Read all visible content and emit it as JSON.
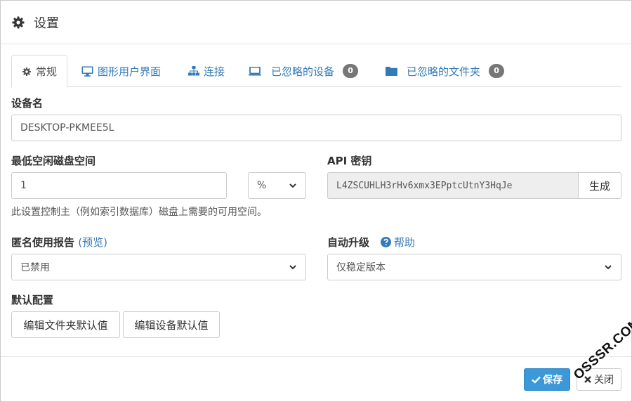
{
  "header": {
    "title": "设置",
    "icon": "gear-icon"
  },
  "tabs": [
    {
      "label": "常规",
      "icon": "gear-icon",
      "active": true
    },
    {
      "label": "图形用户界面",
      "icon": "desktop-icon"
    },
    {
      "label": "连接",
      "icon": "sitemap-icon"
    },
    {
      "label": "已忽略的设备",
      "icon": "laptop-icon",
      "badge": "0"
    },
    {
      "label": "已忽略的文件夹",
      "icon": "folder-icon",
      "badge": "0"
    }
  ],
  "device_name": {
    "label": "设备名",
    "value": "DESKTOP-PKMEE5L"
  },
  "min_disk": {
    "label": "最低空闲磁盘空间",
    "value": "1",
    "unit": "%",
    "help": "此设置控制主（例如索引数据库）磁盘上需要的可用空间。"
  },
  "api_key": {
    "label": "API 密钥",
    "value": "L4ZSCUHLH3rHv6xmx3EPptcUtnY3HqJe",
    "generate_label": "生成"
  },
  "usage_report": {
    "label": "匿名使用报告",
    "preview_open": "(",
    "preview_link": "预览",
    "preview_close": ")",
    "value": "已禁用"
  },
  "auto_upgrade": {
    "label": "自动升级",
    "help_label": "帮助",
    "value": "仅稳定版本"
  },
  "default_config": {
    "label": "默认配置",
    "edit_folder_label": "编辑文件夹默认值",
    "edit_device_label": "编辑设备默认值"
  },
  "footer": {
    "save_label": "保存",
    "close_label": "关闭"
  },
  "watermark": "OSSSR.COM",
  "colors": {
    "link": "#337ab7",
    "primary": "#3b99d9",
    "badge": "#777777"
  }
}
